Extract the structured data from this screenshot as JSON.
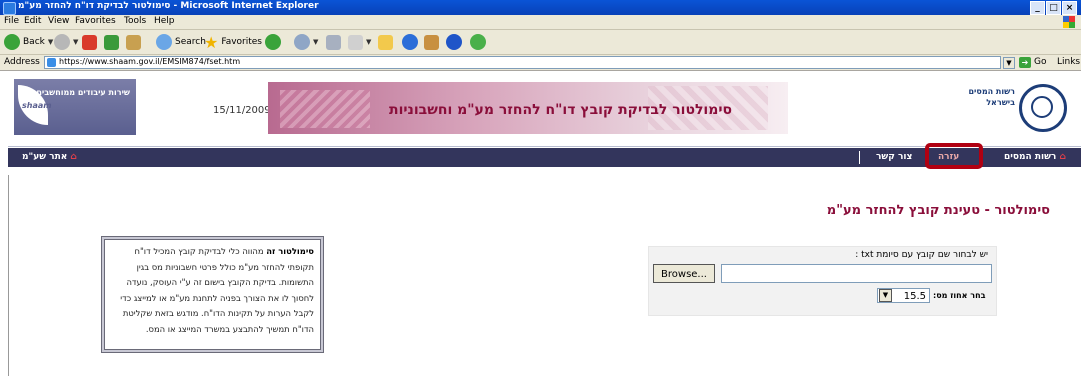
{
  "window": {
    "title": "סימולטור לבדיקת דו\"ח להחזר מע\"מ - Microsoft Internet Explorer",
    "buttons": [
      "_",
      "□",
      "×"
    ]
  },
  "menu": [
    "File",
    "Edit",
    "View",
    "Favorites",
    "Tools",
    "Help"
  ],
  "toolbar": {
    "back": "Back",
    "search": "Search",
    "favorites": "Favorites"
  },
  "address": {
    "label": "Address",
    "url": "https://www.shaam.gov.il/EMSIM874/fset.htm",
    "go": "Go",
    "links": "Links"
  },
  "header": {
    "left_logo_text": "שירות עיבודים ממוחשבים",
    "left_logo_caption": "shaam",
    "date": "15/11/2009",
    "banner_title": "סימולטור לבדיקת קובץ דו\"ח להחזר מע\"מ וחשבוניות",
    "right_logo_text": "רשות המסים בישראל"
  },
  "nav": {
    "home": "רשות המסים",
    "help": "עזרה",
    "contact": "צור קשר",
    "shaam_site": "אתר שע\"מ"
  },
  "main": {
    "heading": "סימולטור - טעינת קובץ להחזר מע\"מ",
    "info_bold": "סימולטור זה",
    "info_text": "מהווה כלי לבדיקת קובץ המכיל דו\"ח תקופתי להחזר מע\"מ כולל פרטי חשבוניות מס בגין התשומות. בדיקת הקובץ בישום זה ע\"י העוסק, נועדה לחסוך לו את הצורך בפניה לתחנת מע\"מ או למייצג כדי לקבל הערות על תקינות הדו\"ח. מודגש בזאת שקליטת הדו\"ח תמשיך להתבצע במשרד המייצג או המס.",
    "upload_label": "יש לבחור שם קובץ עם סיומת txt :",
    "browse_label": "Browse...",
    "version_label": "בחר אחוז מס:",
    "version_value": "15.5"
  }
}
